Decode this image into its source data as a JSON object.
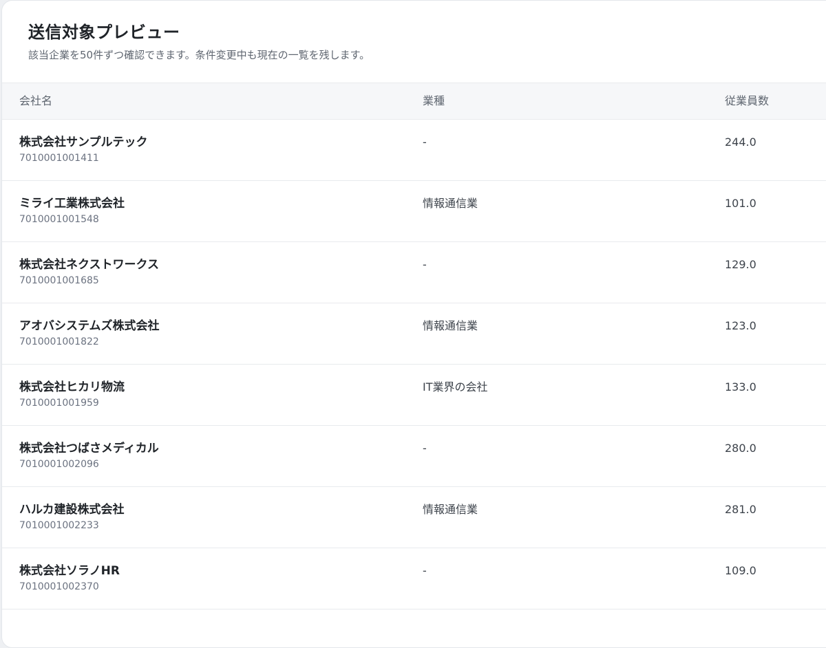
{
  "header": {
    "title": "送信対象プレビュー",
    "subtitle": "該当企業を50件ずつ確認できます。条件変更中も現在の一覧を残します。"
  },
  "table": {
    "columns": {
      "company": "会社名",
      "industry": "業種",
      "employees": "従業員数"
    },
    "rows": [
      {
        "company": "株式会社サンプルテック",
        "corp_no": "7010001001411",
        "industry": "-",
        "employees": "244.0"
      },
      {
        "company": "ミライ工業株式会社",
        "corp_no": "7010001001548",
        "industry": "情報通信業",
        "employees": "101.0"
      },
      {
        "company": "株式会社ネクストワークス",
        "corp_no": "7010001001685",
        "industry": "-",
        "employees": "129.0"
      },
      {
        "company": "アオバシステムズ株式会社",
        "corp_no": "7010001001822",
        "industry": "情報通信業",
        "employees": "123.0"
      },
      {
        "company": "株式会社ヒカリ物流",
        "corp_no": "7010001001959",
        "industry": "IT業界の会社",
        "employees": "133.0"
      },
      {
        "company": "株式会社つばさメディカル",
        "corp_no": "7010001002096",
        "industry": "-",
        "employees": "280.0"
      },
      {
        "company": "ハルカ建設株式会社",
        "corp_no": "7010001002233",
        "industry": "情報通信業",
        "employees": "281.0"
      },
      {
        "company": "株式会社ソラノHR",
        "corp_no": "7010001002370",
        "industry": "-",
        "employees": "109.0"
      }
    ]
  }
}
